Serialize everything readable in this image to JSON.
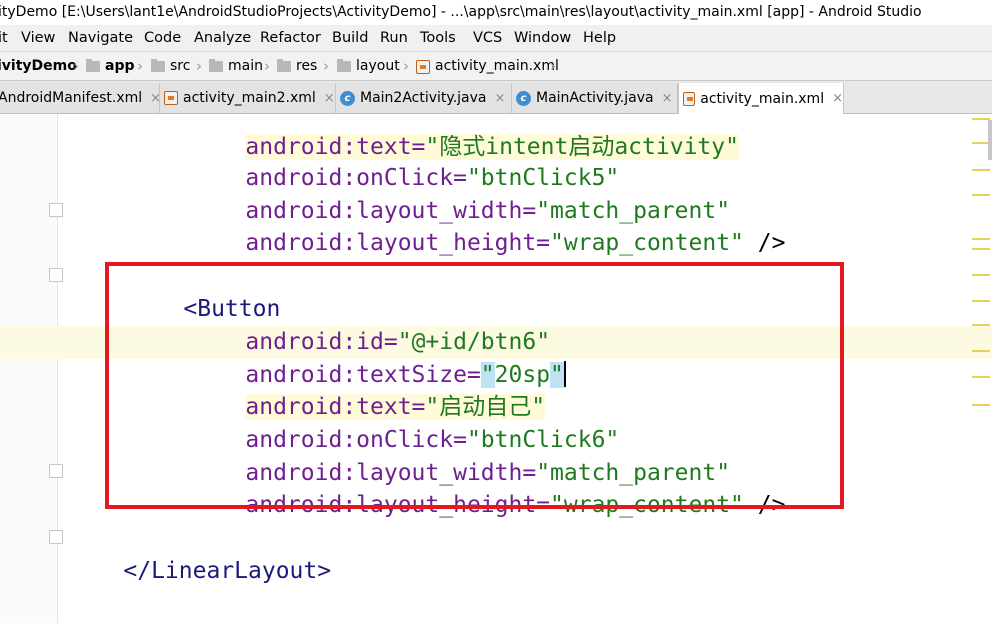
{
  "window": {
    "title": "ityDemo [E:\\Users\\lant1e\\AndroidStudioProjects\\ActivityDemo] - ...\\app\\src\\main\\res\\layout\\activity_main.xml [app] - Android Studio"
  },
  "menu": [
    "it",
    "View",
    "Navigate",
    "Code",
    "Analyze",
    "Refactor",
    "Build",
    "Run",
    "Tools",
    "VCS",
    "Window",
    "Help"
  ],
  "breadcrumbs": [
    "ivityDemo",
    "app",
    "src",
    "main",
    "res",
    "layout",
    "activity_main.xml"
  ],
  "tabs": [
    {
      "label": "AndroidManifest.xml",
      "close": "×"
    },
    {
      "label": "activity_main2.xml",
      "close": "×"
    },
    {
      "label": "Main2Activity.java",
      "close": "×"
    },
    {
      "label": "MainActivity.java",
      "close": "×"
    },
    {
      "label": "activity_main.xml",
      "close": "×"
    }
  ],
  "code": {
    "l0": {
      "attr": "android:text=",
      "val": "\"隐式intent启动activity\""
    },
    "l1": {
      "attr": "android:onClick=",
      "val": "\"btnClick5\""
    },
    "l2": {
      "attr": "android:layout_width=",
      "val": "\"match_parent\""
    },
    "l3": {
      "attr": "android:layout_height=",
      "val": "\"wrap_content\"",
      "end": " />"
    },
    "l5": {
      "tag": "<Button"
    },
    "l6": {
      "attr": "android:id=",
      "val": "\"@+id/btn6\""
    },
    "l7": {
      "attr": "android:textSize=",
      "q1": "\"",
      "val": "20sp",
      "q2": "\""
    },
    "l8": {
      "attr": "android:text=",
      "val": "\"启动自己\""
    },
    "l9": {
      "attr": "android:onClick=",
      "val": "\"btnClick6\""
    },
    "l10": {
      "attr": "android:layout_width=",
      "val": "\"match_parent\""
    },
    "l11": {
      "attr": "android:layout_height=",
      "val": "\"wrap_content\"",
      "end": " />"
    },
    "l13": {
      "tag": "</LinearLayout>"
    }
  },
  "colors": {
    "highlight_box": "#e2191f",
    "attribute": "#6f1f8f",
    "value": "#1f7a1f",
    "selection": "#bfe3f5"
  }
}
